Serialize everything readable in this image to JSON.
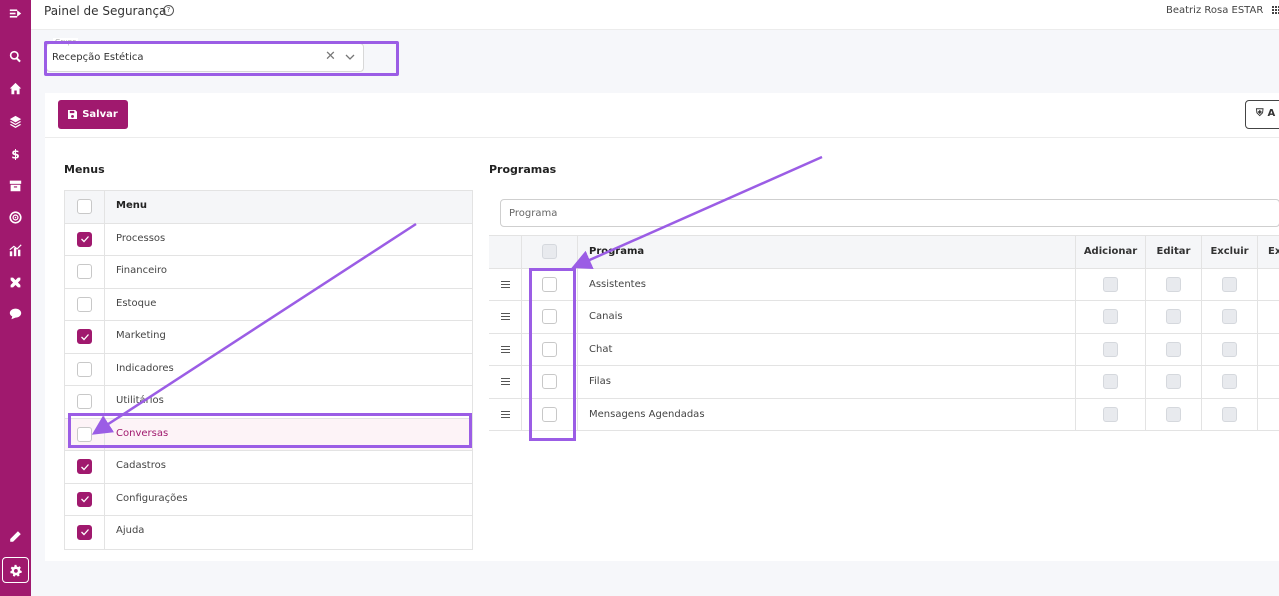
{
  "header": {
    "title": "Painel de Segurança",
    "user_name": "Beatriz Rosa ESTAR"
  },
  "group_field": {
    "label": "Grupo",
    "value": "Recepção Estética"
  },
  "toolbar": {
    "save_label": "Salvar",
    "right_button_label": "A"
  },
  "menus": {
    "title": "Menus",
    "column_header": "Menu",
    "items": [
      {
        "label": "Processos",
        "checked": true
      },
      {
        "label": "Financeiro",
        "checked": false
      },
      {
        "label": "Estoque",
        "checked": false
      },
      {
        "label": "Marketing",
        "checked": true
      },
      {
        "label": "Indicadores",
        "checked": false
      },
      {
        "label": "Utilitários",
        "checked": false
      },
      {
        "label": "Conversas",
        "checked": false
      },
      {
        "label": "Cadastros",
        "checked": true
      },
      {
        "label": "Configurações",
        "checked": true
      },
      {
        "label": "Ajuda",
        "checked": true
      }
    ]
  },
  "programs": {
    "title": "Programas",
    "search_placeholder": "Programa",
    "columns": {
      "name": "Programa",
      "add": "Adicionar",
      "edit": "Editar",
      "delete": "Excluir",
      "extra": "Ex"
    },
    "rows": [
      {
        "label": "Assistentes"
      },
      {
        "label": "Canais"
      },
      {
        "label": "Chat"
      },
      {
        "label": "Filas"
      },
      {
        "label": "Mensagens Agendadas"
      }
    ]
  },
  "icons": {
    "sidebar_top": [
      "collapse-menu-icon",
      "search-icon",
      "home-icon",
      "layers-icon",
      "dollar-icon",
      "archive-icon",
      "target-icon",
      "chart-icon",
      "tools-icon",
      "chat-bubble-icon"
    ],
    "sidebar_bottom": [
      "pencil-icon",
      "gear-icon"
    ]
  },
  "colors": {
    "brand": "#a0196e",
    "annotation": "#9b5de5"
  }
}
